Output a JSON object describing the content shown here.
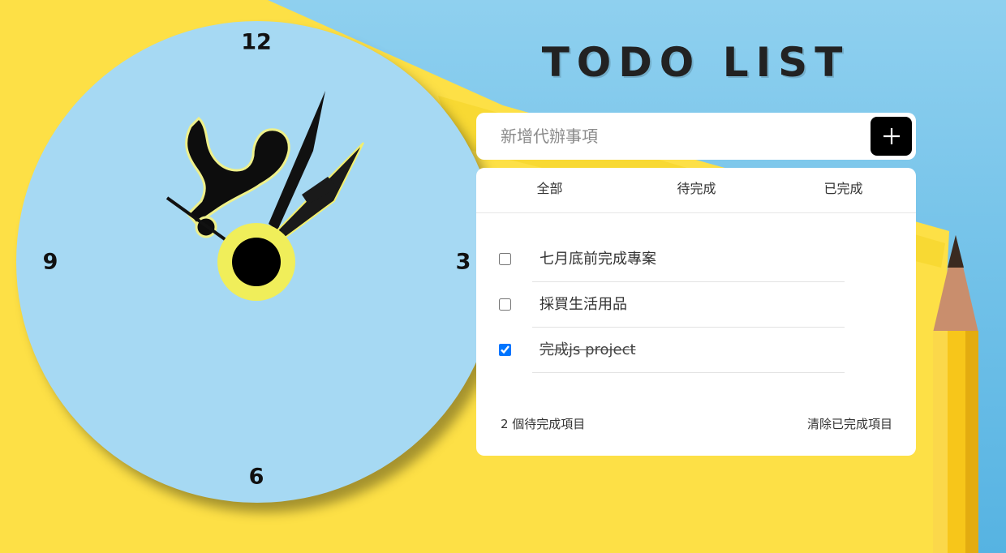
{
  "app": {
    "title": "TODO LIST"
  },
  "clock": {
    "numbers": {
      "twelve": "12",
      "three": "3",
      "six": "6",
      "nine": "9"
    },
    "face_color": "#a6d9f3",
    "center_ring_color": "#f0ee5a"
  },
  "input": {
    "placeholder": "新增代辦事項",
    "value": "",
    "add_button_icon": "plus-icon"
  },
  "tabs": [
    {
      "label": "全部"
    },
    {
      "label": "待完成"
    },
    {
      "label": "已完成"
    }
  ],
  "todos": [
    {
      "text": "七月底前完成專案",
      "done": false
    },
    {
      "text": "採買生活用品",
      "done": false
    },
    {
      "text": "完成js project",
      "done": true
    }
  ],
  "footer": {
    "pending_count": "2 個待完成項目",
    "clear_label": "清除已完成項目"
  },
  "colors": {
    "background": "#6fc0e8",
    "paper_yellow": "#fde046",
    "pencil_yellow": "#f7c61a",
    "card": "#ffffff",
    "button": "#000000"
  }
}
